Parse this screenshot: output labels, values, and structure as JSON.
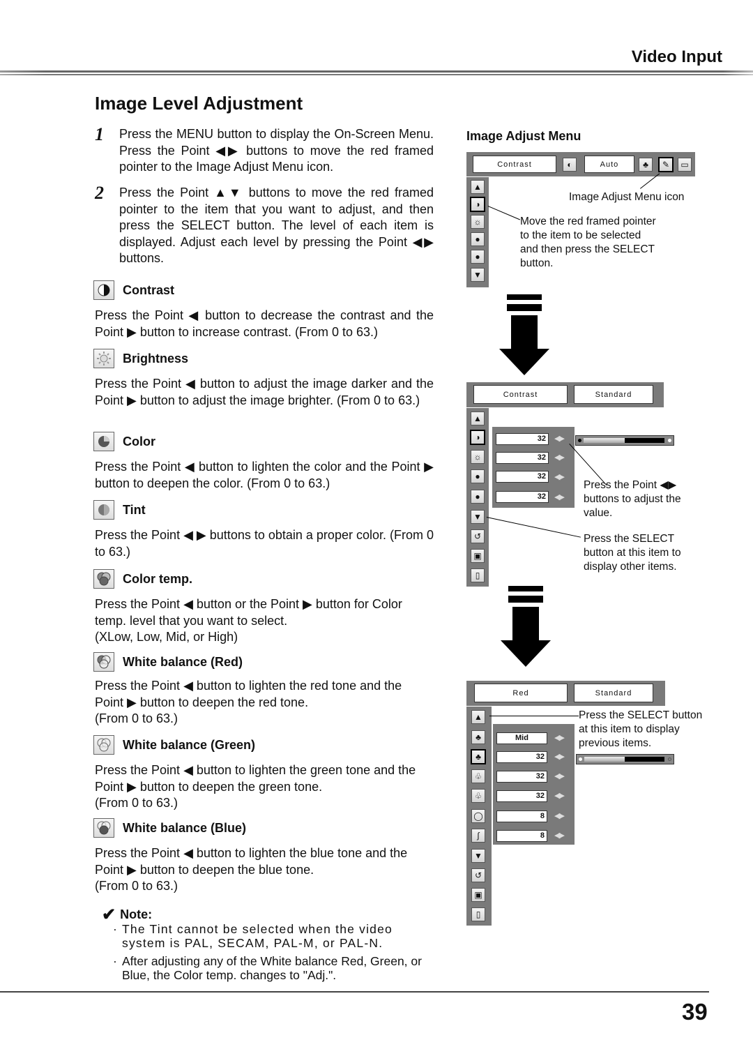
{
  "header": {
    "section": "Video Input"
  },
  "page_title": "Image Level Adjustment",
  "steps": [
    {
      "num": "1",
      "text": "Press the MENU button to display the On-Screen Menu.  Press the Point ◀▶ buttons to move the red framed pointer to the Image Adjust Menu icon."
    },
    {
      "num": "2",
      "text": "Press the Point ▲▼ buttons to move the red framed pointer to the item that you want to adjust, and then press the SELECT button.  The level of each item is displayed.  Adjust each level by pressing the Point ◀▶ buttons."
    }
  ],
  "sections": [
    {
      "icon": "contrast-icon",
      "title": "Contrast",
      "text": "Press the Point ◀ button to decrease the contrast and the Point ▶ button to increase contrast. (From 0 to 63.)"
    },
    {
      "icon": "brightness-icon",
      "title": "Brightness",
      "text": "Press the Point ◀ button to adjust the image darker and the Point ▶ button to adjust the image brighter. (From 0 to 63.)"
    },
    {
      "icon": "color-icon",
      "title": "Color",
      "text": "Press the Point ◀ button to lighten the color and the Point ▶ button to deepen the color. (From 0 to 63.)"
    },
    {
      "icon": "tint-icon",
      "title": "Tint",
      "text": "Press the Point ◀ ▶ buttons to obtain a proper color. (From 0 to 63.)"
    },
    {
      "icon": "color-temp-icon",
      "title": "Color temp.",
      "text": "Press the Point ◀ button or the Point ▶ button for Color temp. level that you want to select.",
      "extra": "(XLow, Low, Mid, or High)"
    },
    {
      "icon": "white-balance-red-icon",
      "title": "White balance (Red)",
      "text": "Press the Point ◀ button to lighten the red tone and the Point ▶ button to deepen the red tone.",
      "extra": "(From 0 to 63.)"
    },
    {
      "icon": "white-balance-green-icon",
      "title": "White balance (Green)",
      "text": "Press the Point ◀ button to lighten the green tone and the Point ▶ button to deepen the green tone.",
      "extra": "(From 0 to 63.)"
    },
    {
      "icon": "white-balance-blue-icon",
      "title": "White balance (Blue)",
      "text": "Press the Point ◀ button to lighten the blue tone and the Point ▶ button to deepen the blue tone.",
      "extra": "(From 0 to 63.)"
    }
  ],
  "note": {
    "label": "Note:",
    "items": [
      "The Tint cannot be selected when the video system is PAL, SECAM, PAL-M, or PAL-N.",
      "After adjusting any of the White balance Red, Green, or Blue, the Color temp. changes to \"Adj.\"."
    ]
  },
  "page_number": "39",
  "diagram": {
    "title": "Image Adjust Menu",
    "menu1": {
      "item_label": "Contrast",
      "mode_label": "Auto",
      "callout_icon": "Image Adjust Menu icon",
      "callout_pointer": "Move the red framed pointer to the item to be selected and then press the SELECT button."
    },
    "menu2": {
      "item_label": "Contrast",
      "mode_label": "Standard",
      "values": [
        "32",
        "32",
        "32",
        "32"
      ],
      "slider_level": 32,
      "slider_max": 63,
      "callout_adjust": "Press the Point ◀▶ buttons to adjust the value.",
      "callout_next": "Press the SELECT button at this item to display other items."
    },
    "menu3": {
      "item_label": "Red",
      "mode_label": "Standard",
      "values": [
        "Mid",
        "32",
        "32",
        "32",
        "8",
        "8"
      ],
      "slider_level": 32,
      "slider_max": 63,
      "callout_prev": "Press the SELECT button at this item to display previous items."
    }
  }
}
